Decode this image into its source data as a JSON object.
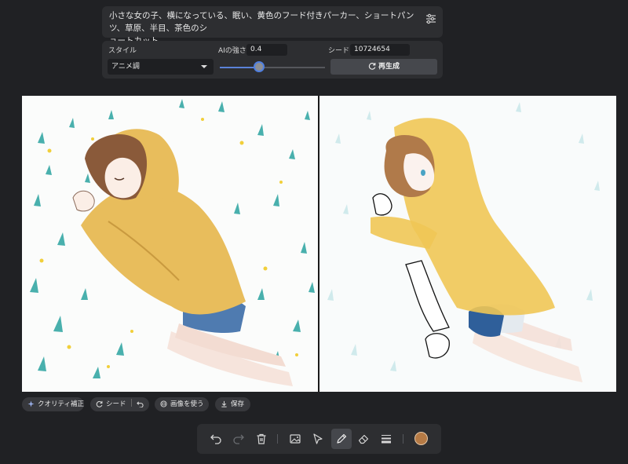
{
  "prompt": {
    "line1": "小さな女の子、横になっている、眠い、黄色のフード付きパーカー、ショートパンツ、草原、半目、茶色のシ",
    "line2": "ョートカット"
  },
  "controls": {
    "style_label": "スタイル",
    "style_value": "アニメ調",
    "ai_strength_label": "AIの強さ",
    "ai_strength_value": "0.4",
    "ai_strength_level": 0.4,
    "seed_label": "シード",
    "seed_value": "10724654",
    "regenerate_label": "再生成"
  },
  "actions": {
    "quality": "クオリティ補正",
    "seed": "シード",
    "use_image": "画像を使う",
    "save": "保存"
  },
  "toolbar": {
    "tools": [
      "undo-icon",
      "redo-icon",
      "trash-icon",
      "image-icon",
      "cursor-icon",
      "pencil-icon",
      "eraser-icon",
      "stroke-width-icon",
      "color-swatch"
    ],
    "active_tool": "pencil-icon",
    "color": "#b57a45"
  },
  "colors": {
    "accent": "#4f7fe0",
    "background": "#202124",
    "panel": "#2d2e31",
    "hoodie": "#e8bd5c",
    "shorts": "#4f7bb0",
    "hair": "#8a5a3a",
    "grass": "#2aa3a0"
  }
}
